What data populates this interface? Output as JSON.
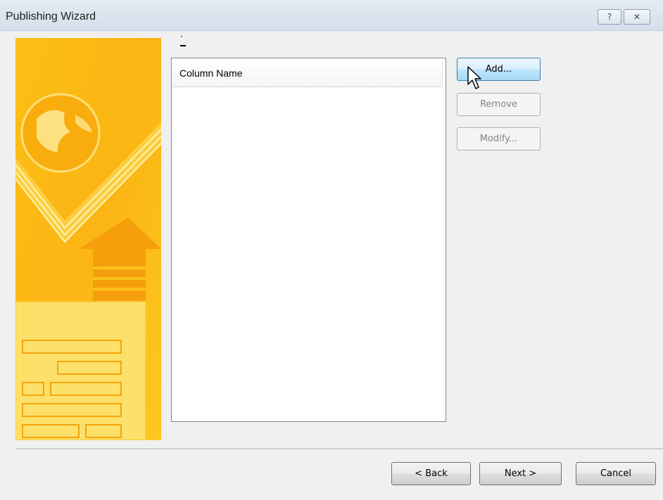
{
  "window": {
    "title": "Publishing Wizard",
    "help_glyph": "?",
    "close_glyph": "✕"
  },
  "list": {
    "top_marker": "·",
    "column_header": "Column Name",
    "rows": []
  },
  "side_buttons": {
    "add_label": "Add...",
    "remove_label": "Remove",
    "modify_label": "Modify..."
  },
  "footer": {
    "back_label": "< Back",
    "next_label": "Next >",
    "cancel_label": "Cancel"
  },
  "colors": {
    "banner_primary": "#fcc21a",
    "banner_accent": "#f7a608",
    "hover_button": "#bee6fd"
  },
  "icons": {
    "cursor": "mouse-pointer-icon",
    "banner": "publishing-banner-illustration"
  }
}
